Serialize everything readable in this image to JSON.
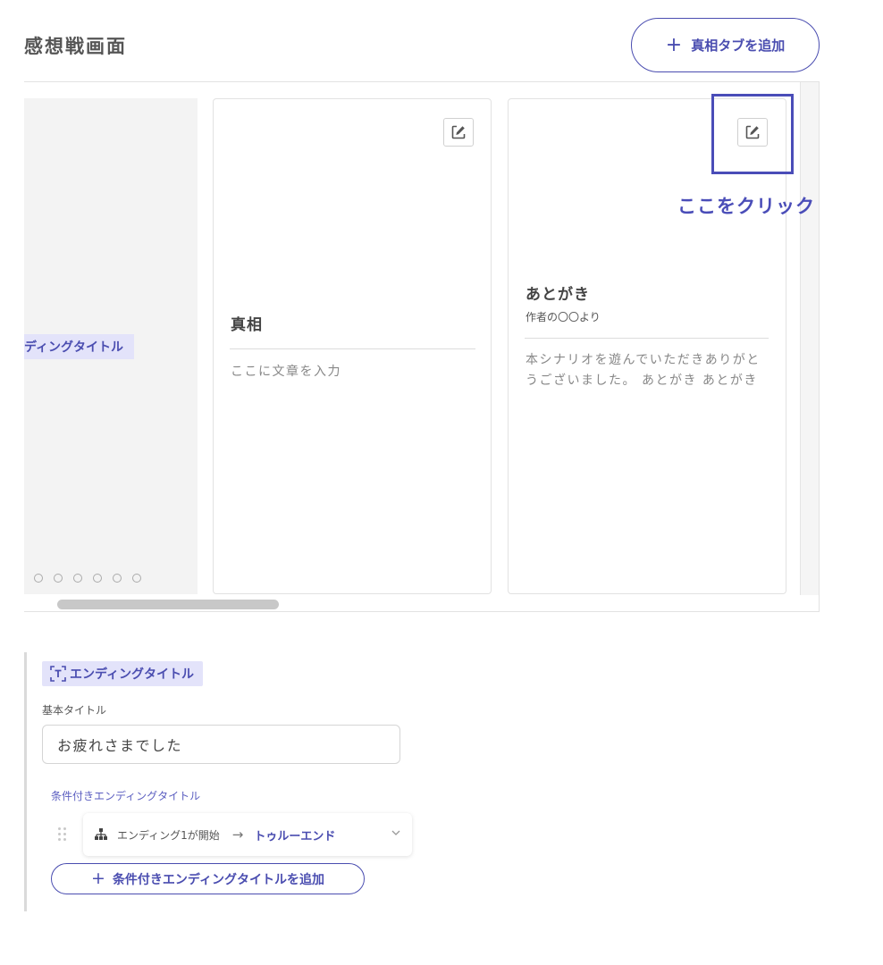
{
  "header": {
    "title": "感想戦画面",
    "add_tab_button": {
      "icon": "plus-icon",
      "label": "真相タブを追加"
    }
  },
  "cards": {
    "partial": {
      "ending_tag": "ディングタイトル",
      "dot_count": 6
    },
    "items": [
      {
        "title": "真相",
        "subtitle": "",
        "body": "ここに文章を入力",
        "edit_icon": "edit-icon"
      },
      {
        "title": "あとがき",
        "subtitle": "作者の〇〇より",
        "body": "本シナリオを遊んでいただきありがとうございました。 あとがき あとがき",
        "edit_icon": "edit-icon"
      }
    ]
  },
  "annotation": {
    "callout": "ここをクリック",
    "color": "#4a4db8"
  },
  "ending": {
    "tag_label": "エンディングタイトル",
    "tag_icon": "text-frame-icon",
    "basic_title_label": "基本タイトル",
    "basic_title_value": "お疲れさまでした",
    "conditional_label": "条件付きエンディングタイトル",
    "conditions": [
      {
        "icon": "tree-icon",
        "condition": "エンディング1が開始",
        "arrow": "→",
        "result": "トゥルーエンド"
      }
    ],
    "add_conditional_button": {
      "icon": "plus-icon",
      "label": "条件付きエンディングタイトルを追加"
    }
  },
  "colors": {
    "accent": "#4a4db0",
    "tag_bg": "#e3e3fa"
  }
}
